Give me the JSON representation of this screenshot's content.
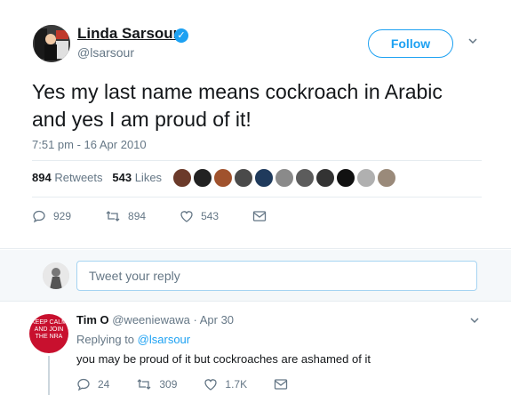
{
  "tweet": {
    "author_name": "Linda Sarsour",
    "author_handle": "@lsarsour",
    "follow_label": "Follow",
    "text": "Yes my last name means cockroach in Arabic and yes I am proud of it!",
    "timestamp": "7:51 pm - 16 Apr 2010",
    "retweets_count": "894",
    "retweets_label": "Retweets",
    "likes_count": "543",
    "likes_label": "Likes",
    "actions": {
      "replies": "929",
      "retweets": "894",
      "likes": "543"
    }
  },
  "reply_box": {
    "placeholder": "Tweet your reply"
  },
  "reply": {
    "author_name": "Tim O",
    "author_handle": "@weeniewawa",
    "date": "· Apr 30",
    "replying_prefix": "Replying to",
    "replying_to": "@lsarsour",
    "text": "you may be proud of it but cockroaches are ashamed of it",
    "avatar_text": "KEEP CALM AND JOIN THE NRA",
    "actions": {
      "replies": "24",
      "retweets": "309",
      "likes": "1.7K"
    }
  },
  "colors": {
    "accent": "#1da1f2",
    "muted": "#657786",
    "text": "#14171a"
  }
}
